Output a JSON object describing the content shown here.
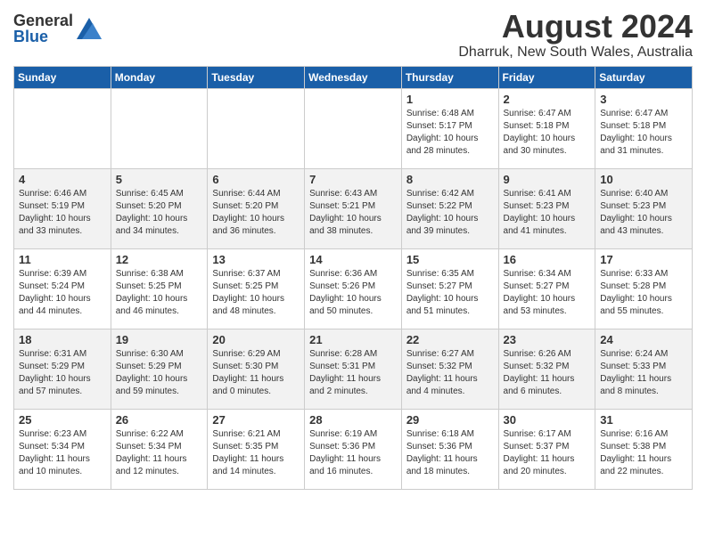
{
  "header": {
    "logo_general": "General",
    "logo_blue": "Blue",
    "month_year": "August 2024",
    "location": "Dharruk, New South Wales, Australia"
  },
  "days_of_week": [
    "Sunday",
    "Monday",
    "Tuesday",
    "Wednesday",
    "Thursday",
    "Friday",
    "Saturday"
  ],
  "weeks": [
    {
      "days": [
        {
          "number": "",
          "info": ""
        },
        {
          "number": "",
          "info": ""
        },
        {
          "number": "",
          "info": ""
        },
        {
          "number": "",
          "info": ""
        },
        {
          "number": "1",
          "info": "Sunrise: 6:48 AM\nSunset: 5:17 PM\nDaylight: 10 hours\nand 28 minutes."
        },
        {
          "number": "2",
          "info": "Sunrise: 6:47 AM\nSunset: 5:18 PM\nDaylight: 10 hours\nand 30 minutes."
        },
        {
          "number": "3",
          "info": "Sunrise: 6:47 AM\nSunset: 5:18 PM\nDaylight: 10 hours\nand 31 minutes."
        }
      ]
    },
    {
      "days": [
        {
          "number": "4",
          "info": "Sunrise: 6:46 AM\nSunset: 5:19 PM\nDaylight: 10 hours\nand 33 minutes."
        },
        {
          "number": "5",
          "info": "Sunrise: 6:45 AM\nSunset: 5:20 PM\nDaylight: 10 hours\nand 34 minutes."
        },
        {
          "number": "6",
          "info": "Sunrise: 6:44 AM\nSunset: 5:20 PM\nDaylight: 10 hours\nand 36 minutes."
        },
        {
          "number": "7",
          "info": "Sunrise: 6:43 AM\nSunset: 5:21 PM\nDaylight: 10 hours\nand 38 minutes."
        },
        {
          "number": "8",
          "info": "Sunrise: 6:42 AM\nSunset: 5:22 PM\nDaylight: 10 hours\nand 39 minutes."
        },
        {
          "number": "9",
          "info": "Sunrise: 6:41 AM\nSunset: 5:23 PM\nDaylight: 10 hours\nand 41 minutes."
        },
        {
          "number": "10",
          "info": "Sunrise: 6:40 AM\nSunset: 5:23 PM\nDaylight: 10 hours\nand 43 minutes."
        }
      ]
    },
    {
      "days": [
        {
          "number": "11",
          "info": "Sunrise: 6:39 AM\nSunset: 5:24 PM\nDaylight: 10 hours\nand 44 minutes."
        },
        {
          "number": "12",
          "info": "Sunrise: 6:38 AM\nSunset: 5:25 PM\nDaylight: 10 hours\nand 46 minutes."
        },
        {
          "number": "13",
          "info": "Sunrise: 6:37 AM\nSunset: 5:25 PM\nDaylight: 10 hours\nand 48 minutes."
        },
        {
          "number": "14",
          "info": "Sunrise: 6:36 AM\nSunset: 5:26 PM\nDaylight: 10 hours\nand 50 minutes."
        },
        {
          "number": "15",
          "info": "Sunrise: 6:35 AM\nSunset: 5:27 PM\nDaylight: 10 hours\nand 51 minutes."
        },
        {
          "number": "16",
          "info": "Sunrise: 6:34 AM\nSunset: 5:27 PM\nDaylight: 10 hours\nand 53 minutes."
        },
        {
          "number": "17",
          "info": "Sunrise: 6:33 AM\nSunset: 5:28 PM\nDaylight: 10 hours\nand 55 minutes."
        }
      ]
    },
    {
      "days": [
        {
          "number": "18",
          "info": "Sunrise: 6:31 AM\nSunset: 5:29 PM\nDaylight: 10 hours\nand 57 minutes."
        },
        {
          "number": "19",
          "info": "Sunrise: 6:30 AM\nSunset: 5:29 PM\nDaylight: 10 hours\nand 59 minutes."
        },
        {
          "number": "20",
          "info": "Sunrise: 6:29 AM\nSunset: 5:30 PM\nDaylight: 11 hours\nand 0 minutes."
        },
        {
          "number": "21",
          "info": "Sunrise: 6:28 AM\nSunset: 5:31 PM\nDaylight: 11 hours\nand 2 minutes."
        },
        {
          "number": "22",
          "info": "Sunrise: 6:27 AM\nSunset: 5:32 PM\nDaylight: 11 hours\nand 4 minutes."
        },
        {
          "number": "23",
          "info": "Sunrise: 6:26 AM\nSunset: 5:32 PM\nDaylight: 11 hours\nand 6 minutes."
        },
        {
          "number": "24",
          "info": "Sunrise: 6:24 AM\nSunset: 5:33 PM\nDaylight: 11 hours\nand 8 minutes."
        }
      ]
    },
    {
      "days": [
        {
          "number": "25",
          "info": "Sunrise: 6:23 AM\nSunset: 5:34 PM\nDaylight: 11 hours\nand 10 minutes."
        },
        {
          "number": "26",
          "info": "Sunrise: 6:22 AM\nSunset: 5:34 PM\nDaylight: 11 hours\nand 12 minutes."
        },
        {
          "number": "27",
          "info": "Sunrise: 6:21 AM\nSunset: 5:35 PM\nDaylight: 11 hours\nand 14 minutes."
        },
        {
          "number": "28",
          "info": "Sunrise: 6:19 AM\nSunset: 5:36 PM\nDaylight: 11 hours\nand 16 minutes."
        },
        {
          "number": "29",
          "info": "Sunrise: 6:18 AM\nSunset: 5:36 PM\nDaylight: 11 hours\nand 18 minutes."
        },
        {
          "number": "30",
          "info": "Sunrise: 6:17 AM\nSunset: 5:37 PM\nDaylight: 11 hours\nand 20 minutes."
        },
        {
          "number": "31",
          "info": "Sunrise: 6:16 AM\nSunset: 5:38 PM\nDaylight: 11 hours\nand 22 minutes."
        }
      ]
    }
  ]
}
